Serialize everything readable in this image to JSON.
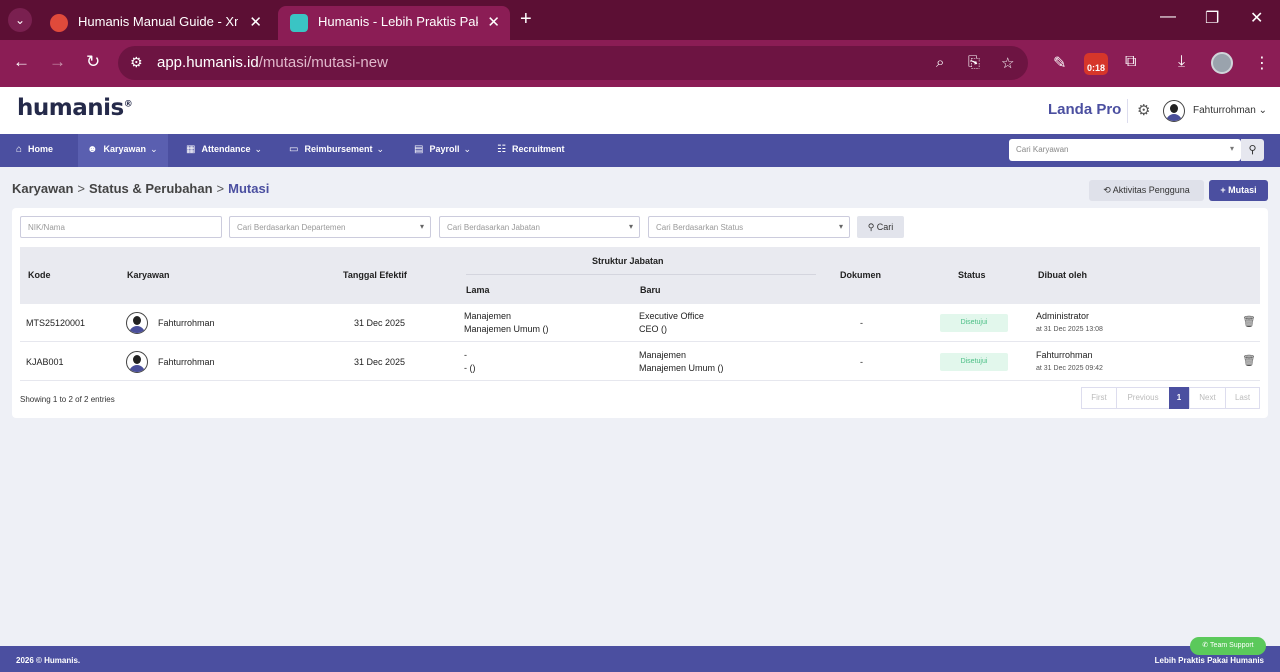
{
  "browser": {
    "tabs": [
      {
        "title": "Humanis Manual Guide - Xmind"
      },
      {
        "title": "Humanis - Lebih Praktis Pakai Humanis"
      }
    ],
    "url_domain": "app.humanis.id",
    "url_path": "/mutasi/mutasi-new",
    "timer_badge": "0:18"
  },
  "header": {
    "logo": "humanis",
    "logo_mark": "®",
    "company": "Landa Pro",
    "user": "Fahturrohman"
  },
  "nav": {
    "items": [
      {
        "label": "Home",
        "icon": "home-icon"
      },
      {
        "label": "Karyawan",
        "icon": "user-edit-icon"
      },
      {
        "label": "Attendance",
        "icon": "calendar-icon"
      },
      {
        "label": "Reimbursement",
        "icon": "money-icon"
      },
      {
        "label": "Payroll",
        "icon": "payroll-icon"
      },
      {
        "label": "Recruitment",
        "icon": "users-icon"
      }
    ],
    "search_placeholder": "Cari Karyawan"
  },
  "breadcrumb": {
    "items": [
      "Karyawan",
      "Status & Perubahan",
      "Mutasi"
    ],
    "separator": ">"
  },
  "actions": {
    "activity_label": "Aktivitas Pengguna",
    "add_label": "Mutasi"
  },
  "filters": {
    "nik_placeholder": "NIK/Nama",
    "department_placeholder": "Cari Berdasarkan Departemen",
    "position_placeholder": "Cari Berdasarkan Jabatan",
    "status_placeholder": "Cari Berdasarkan Status",
    "search_label": "Cari"
  },
  "table": {
    "headers": {
      "kode": "Kode",
      "karyawan": "Karyawan",
      "tanggal": "Tanggal Efektif",
      "struktur": "Struktur Jabatan",
      "lama": "Lama",
      "baru": "Baru",
      "dokumen": "Dokumen",
      "status": "Status",
      "dibuat": "Dibuat oleh"
    },
    "rows": [
      {
        "kode": "MTS25120001",
        "karyawan": "Fahturrohman",
        "tanggal": "31 Dec 2025",
        "lama_1": "Manajemen",
        "lama_2": "Manajemen Umum ()",
        "baru_1": "Executive Office",
        "baru_2": "CEO ()",
        "dokumen": "-",
        "status": "Disetujui",
        "dibuat_oleh": "Administrator",
        "dibuat_at": "at 31 Dec 2025 13:08"
      },
      {
        "kode": "KJAB001",
        "karyawan": "Fahturrohman",
        "tanggal": "31 Dec 2025",
        "lama_1": "-",
        "lama_2": "- ()",
        "baru_1": "Manajemen",
        "baru_2": "Manajemen Umum ()",
        "dokumen": "-",
        "status": "Disetujui",
        "dibuat_oleh": "Fahturrohman",
        "dibuat_at": "at 31 Dec 2025 09:42"
      }
    ],
    "entries_info": "Showing 1 to 2 of 2 entries",
    "pager": {
      "first": "First",
      "previous": "Previous",
      "current": "1",
      "next": "Next",
      "last": "Last"
    }
  },
  "footer": {
    "copyright": "2026 © Humanis.",
    "tagline": "Lebih Praktis Pakai Humanis",
    "support": "Team Support"
  },
  "colors": {
    "brand": "#4b4fa0",
    "browser_frame": "#8b1d55",
    "approved": "#4cbf86"
  }
}
